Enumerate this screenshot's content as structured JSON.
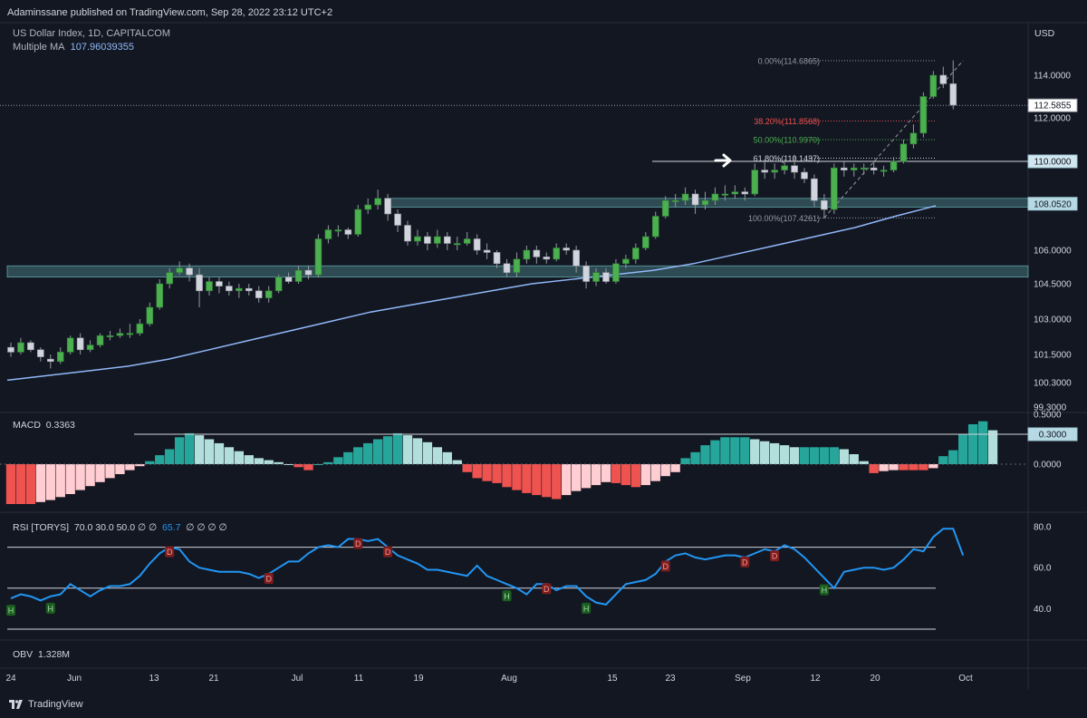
{
  "header": {
    "published": "Adaminssane published on TradingView.com, Sep 28, 2022 23:12 UTC+2",
    "symbol_line": "US Dollar Index, 1D, CAPITALCOM",
    "ma_label": "Multiple MA",
    "ma_value": "107.96039355",
    "currency": "USD"
  },
  "branding": {
    "logo_text": "TradingView"
  },
  "chart_data": {
    "type": "candlestick",
    "title": "US Dollar Index, 1D, CAPITALCOM",
    "price_axis": {
      "ticks": [
        "114.0000",
        "112.0000",
        "110.0000",
        "108.0000",
        "106.0000",
        "104.5000",
        "103.0000",
        "101.5000",
        "100.3000",
        "99.3000"
      ],
      "last_price": "112.5855",
      "highlight_labels": [
        "110.0000",
        "108.0520"
      ]
    },
    "time_axis": {
      "ticks": [
        "24",
        "Jun",
        "13",
        "21",
        "Jul",
        "11",
        "19",
        "Aug",
        "15",
        "23",
        "Sep",
        "12",
        "20",
        "Oct"
      ]
    },
    "candles": [
      [
        101.8,
        101.6,
        102.0,
        101.4
      ],
      [
        101.6,
        102.0,
        102.2,
        101.5
      ],
      [
        102.0,
        101.7,
        102.1,
        101.6
      ],
      [
        101.7,
        101.4,
        101.8,
        101.2
      ],
      [
        101.3,
        101.2,
        101.5,
        100.9
      ],
      [
        101.2,
        101.6,
        101.8,
        101.1
      ],
      [
        101.6,
        102.2,
        102.3,
        101.5
      ],
      [
        102.2,
        101.7,
        102.4,
        101.5
      ],
      [
        101.7,
        101.9,
        102.1,
        101.6
      ],
      [
        101.9,
        102.3,
        102.4,
        101.8
      ],
      [
        102.3,
        102.3,
        102.5,
        102.1
      ],
      [
        102.3,
        102.4,
        102.6,
        102.2
      ],
      [
        102.4,
        102.4,
        102.8,
        102.2
      ],
      [
        102.4,
        102.8,
        103.0,
        102.3
      ],
      [
        102.8,
        103.5,
        103.7,
        102.7
      ],
      [
        103.5,
        104.5,
        104.7,
        103.4
      ],
      [
        104.5,
        105.0,
        105.2,
        104.3
      ],
      [
        105.0,
        105.2,
        105.5,
        104.9
      ],
      [
        105.2,
        104.9,
        105.4,
        104.6
      ],
      [
        104.9,
        104.2,
        105.2,
        103.5
      ],
      [
        104.2,
        104.6,
        104.8,
        104.0
      ],
      [
        104.6,
        104.4,
        104.8,
        104.1
      ],
      [
        104.4,
        104.2,
        104.6,
        104.0
      ],
      [
        104.2,
        104.3,
        104.5,
        103.9
      ],
      [
        104.3,
        104.2,
        104.5,
        104.0
      ],
      [
        104.2,
        103.9,
        104.4,
        103.7
      ],
      [
        103.9,
        104.2,
        104.4,
        103.7
      ],
      [
        104.2,
        104.8,
        104.9,
        104.1
      ],
      [
        104.8,
        104.6,
        105.0,
        104.5
      ],
      [
        104.6,
        105.1,
        105.3,
        104.5
      ],
      [
        105.1,
        104.9,
        105.3,
        104.7
      ],
      [
        104.9,
        106.5,
        106.7,
        104.8
      ],
      [
        106.5,
        106.9,
        107.1,
        106.3
      ],
      [
        106.9,
        106.9,
        107.1,
        106.6
      ],
      [
        106.9,
        106.7,
        107.0,
        106.5
      ],
      [
        106.7,
        107.8,
        108.0,
        106.6
      ],
      [
        107.8,
        108.0,
        108.3,
        107.6
      ],
      [
        108.0,
        108.3,
        108.7,
        107.8
      ],
      [
        108.3,
        107.6,
        108.5,
        107.3
      ],
      [
        107.6,
        107.1,
        107.8,
        106.8
      ],
      [
        107.1,
        106.4,
        107.3,
        106.2
      ],
      [
        106.4,
        106.6,
        106.9,
        106.2
      ],
      [
        106.6,
        106.3,
        106.8,
        106.0
      ],
      [
        106.3,
        106.6,
        106.9,
        106.1
      ],
      [
        106.6,
        106.3,
        106.8,
        106.0
      ],
      [
        106.3,
        106.3,
        106.6,
        106.0
      ],
      [
        106.3,
        106.5,
        106.8,
        106.2
      ],
      [
        106.5,
        106.0,
        106.7,
        105.8
      ],
      [
        106.0,
        105.9,
        106.3,
        105.6
      ],
      [
        105.9,
        105.4,
        106.0,
        105.2
      ],
      [
        105.4,
        105.0,
        105.6,
        104.8
      ],
      [
        105.0,
        105.6,
        105.9,
        104.8
      ],
      [
        105.6,
        106.0,
        106.2,
        105.4
      ],
      [
        106.0,
        105.7,
        106.2,
        105.4
      ],
      [
        105.7,
        105.6,
        105.9,
        105.4
      ],
      [
        105.6,
        106.1,
        106.3,
        105.5
      ],
      [
        106.1,
        106.0,
        106.3,
        105.8
      ],
      [
        106.0,
        105.3,
        106.2,
        105.0
      ],
      [
        105.3,
        104.6,
        105.5,
        104.3
      ],
      [
        104.6,
        105.0,
        105.2,
        104.4
      ],
      [
        105.0,
        104.6,
        105.2,
        104.5
      ],
      [
        104.6,
        105.4,
        105.6,
        104.5
      ],
      [
        105.4,
        105.6,
        105.8,
        105.2
      ],
      [
        105.6,
        106.1,
        106.3,
        105.4
      ],
      [
        106.1,
        106.6,
        106.8,
        106.0
      ],
      [
        106.6,
        107.5,
        107.7,
        106.5
      ],
      [
        107.5,
        108.2,
        108.4,
        107.4
      ],
      [
        108.2,
        108.2,
        108.5,
        107.9
      ],
      [
        108.2,
        108.5,
        108.8,
        108.0
      ],
      [
        108.5,
        108.0,
        108.7,
        107.6
      ],
      [
        108.0,
        108.2,
        108.6,
        107.8
      ],
      [
        108.2,
        108.5,
        108.8,
        108.0
      ],
      [
        108.5,
        108.5,
        108.9,
        108.2
      ],
      [
        108.5,
        108.6,
        108.9,
        108.3
      ],
      [
        108.6,
        108.5,
        108.8,
        108.2
      ],
      [
        108.5,
        109.6,
        109.9,
        108.4
      ],
      [
        109.6,
        109.5,
        110.1,
        109.2
      ],
      [
        109.5,
        109.6,
        109.9,
        109.2
      ],
      [
        109.6,
        109.8,
        110.1,
        109.4
      ],
      [
        109.8,
        109.5,
        110.3,
        109.2
      ],
      [
        109.5,
        109.2,
        109.7,
        109.0
      ],
      [
        109.2,
        108.2,
        109.4,
        107.9
      ],
      [
        108.2,
        107.8,
        108.5,
        107.4
      ],
      [
        107.8,
        109.7,
        109.9,
        107.6
      ],
      [
        109.7,
        109.6,
        110.0,
        109.3
      ],
      [
        109.6,
        109.7,
        109.9,
        109.3
      ],
      [
        109.7,
        109.7,
        109.9,
        109.4
      ],
      [
        109.7,
        109.6,
        110.0,
        109.4
      ],
      [
        109.6,
        109.6,
        109.8,
        109.3
      ],
      [
        109.6,
        110.0,
        110.2,
        109.5
      ],
      [
        110.0,
        110.8,
        111.0,
        109.9
      ],
      [
        110.8,
        111.3,
        111.7,
        110.6
      ],
      [
        111.3,
        113.0,
        113.2,
        111.1
      ],
      [
        113.0,
        114.0,
        114.2,
        112.9
      ],
      [
        114.0,
        113.6,
        114.4,
        113.4
      ],
      [
        113.6,
        112.6,
        114.7,
        112.4
      ]
    ],
    "moving_average": {
      "label": "Multiple MA",
      "value": 107.96039355,
      "points": [
        100.4,
        100.6,
        100.8,
        101.0,
        101.3,
        101.7,
        102.1,
        102.5,
        102.9,
        103.3,
        103.6,
        103.9,
        104.2,
        104.5,
        104.7,
        104.9,
        105.1,
        105.4,
        105.8,
        106.2,
        106.6,
        107.0,
        107.5,
        107.96
      ]
    },
    "fibonacci": [
      {
        "level": "0.00%",
        "price": 114.6865,
        "label": "0.00%(114.6865)"
      },
      {
        "level": "38.20%",
        "price": 111.8568,
        "label": "38.20%(111.8568)"
      },
      {
        "level": "50.00%",
        "price": 110.997,
        "label": "50.00%(110.9970)"
      },
      {
        "level": "61.80%",
        "price": 110.1437,
        "label": "61.80%(110.1437)"
      },
      {
        "level": "100.00%",
        "price": 107.4261,
        "label": "100.00%(107.4261)"
      }
    ],
    "zones": [
      {
        "from": 107.9,
        "to": 108.3
      },
      {
        "from": 104.8,
        "to": 105.3
      }
    ],
    "horizontal_line": 110.0,
    "macd": {
      "label": "MACD",
      "value": "0.3363",
      "axis_ticks": [
        "0.5000",
        "0.3000",
        "0.0000"
      ],
      "level_label": "0.3000",
      "histogram": [
        -0.4,
        -0.4,
        -0.4,
        -0.38,
        -0.36,
        -0.33,
        -0.3,
        -0.26,
        -0.22,
        -0.18,
        -0.14,
        -0.1,
        -0.06,
        -0.02,
        0.03,
        0.09,
        0.15,
        0.27,
        0.31,
        0.29,
        0.25,
        0.21,
        0.17,
        0.13,
        0.09,
        0.06,
        0.04,
        0.02,
        0.0,
        -0.03,
        -0.06,
        0.0,
        0.02,
        0.07,
        0.12,
        0.17,
        0.21,
        0.25,
        0.28,
        0.31,
        0.29,
        0.26,
        0.22,
        0.17,
        0.12,
        0.04,
        -0.08,
        -0.14,
        -0.17,
        -0.19,
        -0.23,
        -0.26,
        -0.29,
        -0.31,
        -0.33,
        -0.35,
        -0.31,
        -0.27,
        -0.24,
        -0.21,
        -0.18,
        -0.19,
        -0.21,
        -0.23,
        -0.21,
        -0.17,
        -0.12,
        -0.08,
        0.06,
        0.12,
        0.19,
        0.24,
        0.27,
        0.27,
        0.27,
        0.25,
        0.23,
        0.21,
        0.19,
        0.17,
        0.17,
        0.17,
        0.17,
        0.17,
        0.15,
        0.1,
        0.03,
        -0.09,
        -0.07,
        -0.06,
        -0.06,
        -0.06,
        -0.06,
        -0.04,
        0.08,
        0.14,
        0.3,
        0.4,
        0.43,
        0.34
      ]
    },
    "rsi": {
      "label": "RSI [TORYS]",
      "params": "70.0 30.0 50.0 ∅ ∅",
      "value": "65.7",
      "trailing": "∅ ∅ ∅ ∅",
      "axis_ticks": [
        "80.0",
        "60.0",
        "40.0"
      ],
      "levels": [
        70,
        50,
        30
      ],
      "points": [
        45,
        47,
        46,
        44,
        46,
        47,
        52,
        49,
        46,
        49,
        51,
        51,
        52,
        56,
        62,
        67,
        70,
        69,
        63,
        60,
        59,
        58,
        58,
        58,
        57,
        55,
        57,
        60,
        63,
        63,
        67,
        70,
        71,
        70,
        74,
        74,
        73,
        74,
        70,
        66,
        64,
        62,
        59,
        59,
        58,
        57,
        56,
        61,
        56,
        54,
        52,
        50,
        47,
        52,
        52,
        49,
        51,
        51,
        46,
        43,
        42,
        47,
        52,
        53,
        54,
        57,
        63,
        66,
        67,
        65,
        64,
        65,
        66,
        66,
        65,
        67,
        69,
        68,
        71,
        69,
        65,
        60,
        55,
        50,
        58,
        59,
        60,
        60,
        59,
        60,
        64,
        69,
        68,
        75,
        79,
        79,
        66
      ],
      "markers": [
        {
          "label": "H",
          "index": 0
        },
        {
          "label": "H",
          "index": 4
        },
        {
          "label": "D",
          "index": 16
        },
        {
          "label": "D",
          "index": 26
        },
        {
          "label": "D",
          "index": 35
        },
        {
          "label": "D",
          "index": 38
        },
        {
          "label": "H",
          "index": 50
        },
        {
          "label": "D",
          "index": 54
        },
        {
          "label": "H",
          "index": 58
        },
        {
          "label": "D",
          "index": 66
        },
        {
          "label": "D",
          "index": 74
        },
        {
          "label": "D",
          "index": 77
        },
        {
          "label": "H",
          "index": 82
        }
      ]
    },
    "obv": {
      "label": "OBV",
      "value": "1.328M"
    }
  }
}
